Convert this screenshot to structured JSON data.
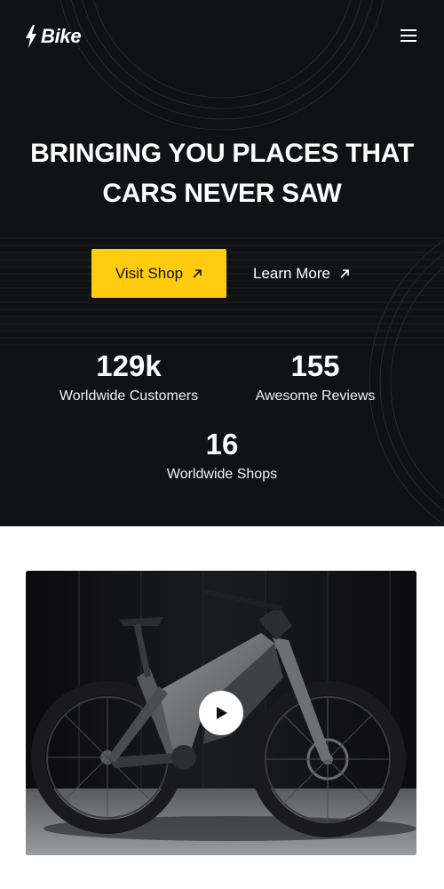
{
  "header": {
    "logo_text": "Bike",
    "logo_icon": "lightning-bolt-icon",
    "menu_icon": "hamburger-menu-icon"
  },
  "hero": {
    "headline_line1": "BRINGING YOU PLACES THAT",
    "headline_line2": "CARS NEVER SAW",
    "primary_button": {
      "label": "Visit Shop",
      "icon": "arrow-up-right-icon"
    },
    "secondary_button": {
      "label": "Learn More",
      "icon": "arrow-up-right-icon"
    },
    "stats": [
      {
        "value": "129k",
        "label": "Worldwide Customers"
      },
      {
        "value": "155",
        "label": "Awesome Reviews"
      },
      {
        "value": "16",
        "label": "Worldwide Shops"
      }
    ]
  },
  "media": {
    "image_subject": "electric mountain bike",
    "play_icon": "play-icon"
  },
  "colors": {
    "hero_background": "#111214",
    "accent": "#ffcc0f",
    "text_light": "#ffffff",
    "page_background": "#ffffff"
  }
}
